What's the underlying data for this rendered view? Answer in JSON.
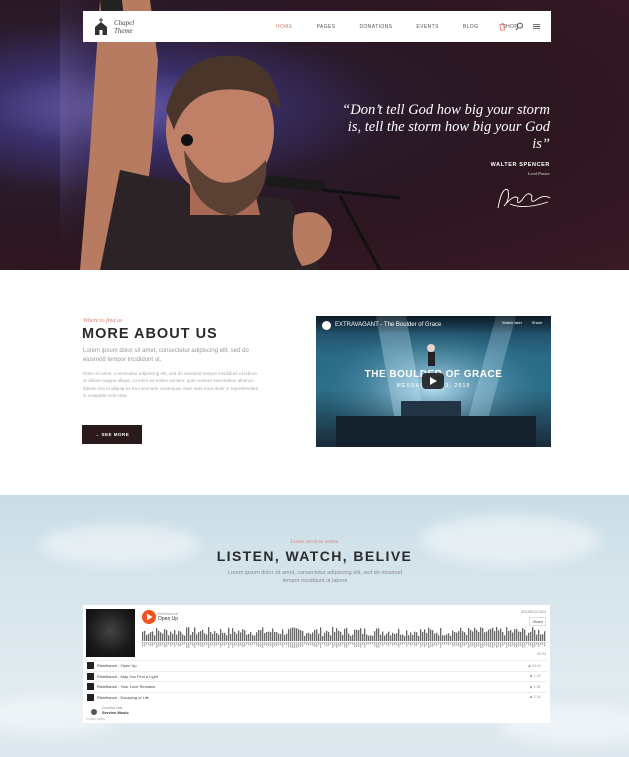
{
  "nav": {
    "logo_line1": "Chapel",
    "logo_line2": "Theme",
    "items": [
      {
        "label": "HOME",
        "active": true
      },
      {
        "label": "PAGES",
        "active": false
      },
      {
        "label": "DONATIONS",
        "active": false
      },
      {
        "label": "EVENTS",
        "active": false
      },
      {
        "label": "BLOG",
        "active": false
      },
      {
        "label": "SHOP",
        "active": false
      }
    ],
    "icons": [
      "cart-icon",
      "search-icon",
      "menu-icon"
    ]
  },
  "hero": {
    "quote": "“Don’t tell God how big your storm is, tell the storm how big your God is”",
    "author": "WALTER SPENCER",
    "role": "Lead Pastor"
  },
  "about": {
    "subtitle": "Where to find us",
    "title": "MORE ABOUT US",
    "lead": "Lorem ipsum dolor sit amet, consectetur adipiscing elit, sed do eiusmod tempor incididunt ut.",
    "body": "Dolor sit amet, consectetur adipiscing elit, sed do eiusmod tempor incididunt ut labore et dolore magna aliqua. Ut enim ad minim veniam, quis nostrud exercitation ullamco laboris nisi ut aliquip ex ea commodo consequat. Duis aute irure dolor in reprehenderit in voluptate velit esse.",
    "button": "→ SEE MORE"
  },
  "video": {
    "title": "EXTRAVAGANT - The Boulder of Grace",
    "watch_later": "Watch later",
    "share": "Share",
    "headline": "THE BOULDER OF GRACE",
    "date": "MESSAGE — 23, 2019"
  },
  "listen": {
    "subtitle": "Listen services online",
    "title": "LISTEN, WATCH, BELIVE",
    "lead": "Lorem ipsum dolor sit amet, consectetur adipiscing elit, sed do eiusmod tempor incididunt ut labore"
  },
  "player": {
    "artist": "Ristrittance",
    "track": "Open Up",
    "brand": "SOUNDCLOUD",
    "share": "Share",
    "duration": "03:24",
    "tracks": [
      {
        "title": "Ristrittance - Open Up",
        "plays": "▶ 03:24"
      },
      {
        "title": "Ristrittance - May You Find a Light",
        "plays": "▶ 1.2K"
      },
      {
        "title": "Ristrittance - Your Love Remains",
        "plays": "▶ 1.8K"
      },
      {
        "title": "Ristrittance - Escaping of Life",
        "plays": "▶ 2.1K"
      }
    ],
    "footer_label": "Cordova Nas",
    "footer_name": "Service Music",
    "cookie": "Cookie policy"
  }
}
